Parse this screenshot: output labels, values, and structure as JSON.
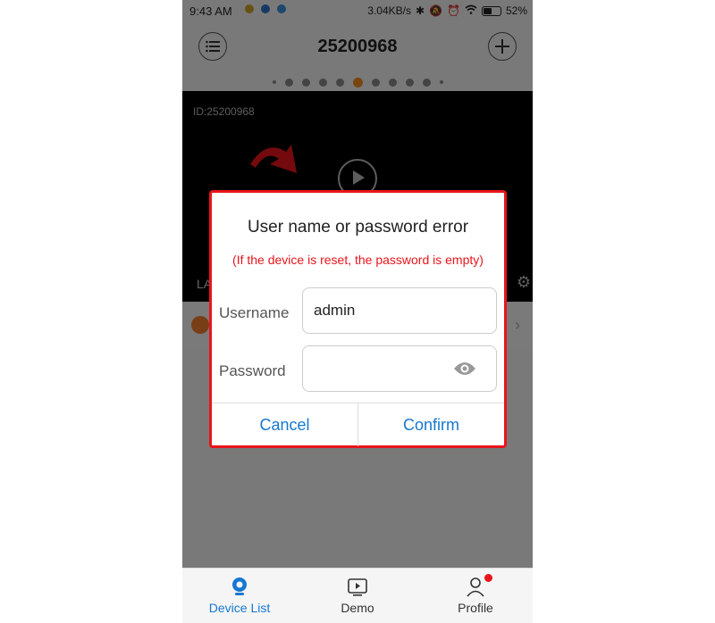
{
  "status_bar": {
    "time": "9:43 AM",
    "net_speed": "3.04KB/s",
    "battery": "52%"
  },
  "app_bar": {
    "title": "25200968",
    "menu_icon": "list-icon",
    "add_icon": "plus-icon"
  },
  "carousel": {
    "dot_count": 11,
    "active_index": 5
  },
  "video": {
    "device_id": "ID:25200968",
    "label_fragment": "LA"
  },
  "dialog": {
    "title": "User name or password error",
    "subtitle": "(If the device is reset, the password is empty)",
    "username_label": "Username",
    "username_value": "admin",
    "password_label": "Password",
    "password_value": "",
    "cancel_label": "Cancel",
    "confirm_label": "Confirm"
  },
  "bottom_nav": {
    "items": [
      {
        "label": "Device List",
        "active": true
      },
      {
        "label": "Demo",
        "active": false
      },
      {
        "label": "Profile",
        "active": false,
        "badge": true
      }
    ]
  },
  "colors": {
    "accent": "#1677d2",
    "error": "#e8151b",
    "active_dot": "#f28a1e"
  }
}
